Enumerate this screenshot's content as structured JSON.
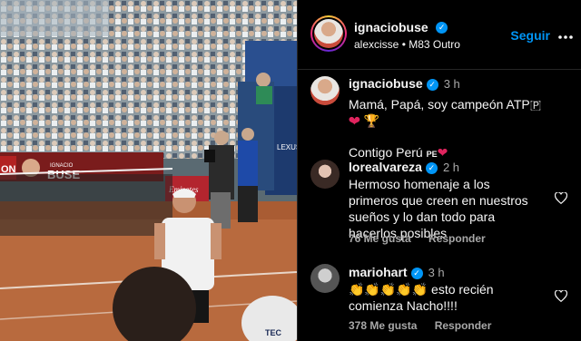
{
  "post": {
    "author": "ignaciobuse",
    "audio": {
      "user": "alexcisse",
      "separator": "•",
      "track": "M83 Outro"
    },
    "follow_label": "Seguir",
    "more_icon": "more-horizontal-icon",
    "verified_icon": "verified-badge-icon"
  },
  "photo": {
    "banner_left": "ON",
    "banner_brand_top": "IGNACIO",
    "banner_brand": "BUSE",
    "sponsor_emirates": "Emirates",
    "sponsor_lexus": "LEXUS",
    "shirt_text": "TEC"
  },
  "caption": {
    "user": "ignaciobuse",
    "time": "3 h",
    "line1": "Mamá, Papá, soy campeón ATP🇵",
    "heart": "❤",
    "trophy": "🏆",
    "line2": "Contigo Perú",
    "flag_text": "PE",
    "heart2": "❤"
  },
  "comments": [
    {
      "user": "lorealvareza",
      "time": "2 h",
      "text": "Hermoso homenaje a los primeros que creen en nuestros sueños y lo dan todo para hacerlos posibles",
      "likes": "76 Me gusta",
      "reply": "Responder"
    },
    {
      "user": "mariohart",
      "time": "3 h",
      "text": "👏👏👏👏👏 esto recién comienza Nacho!!!!",
      "likes": "378 Me gusta",
      "reply": "Responder"
    }
  ],
  "colors": {
    "accent": "#0095f6",
    "muted": "#a8a8a8",
    "heart": "#e0245e"
  }
}
